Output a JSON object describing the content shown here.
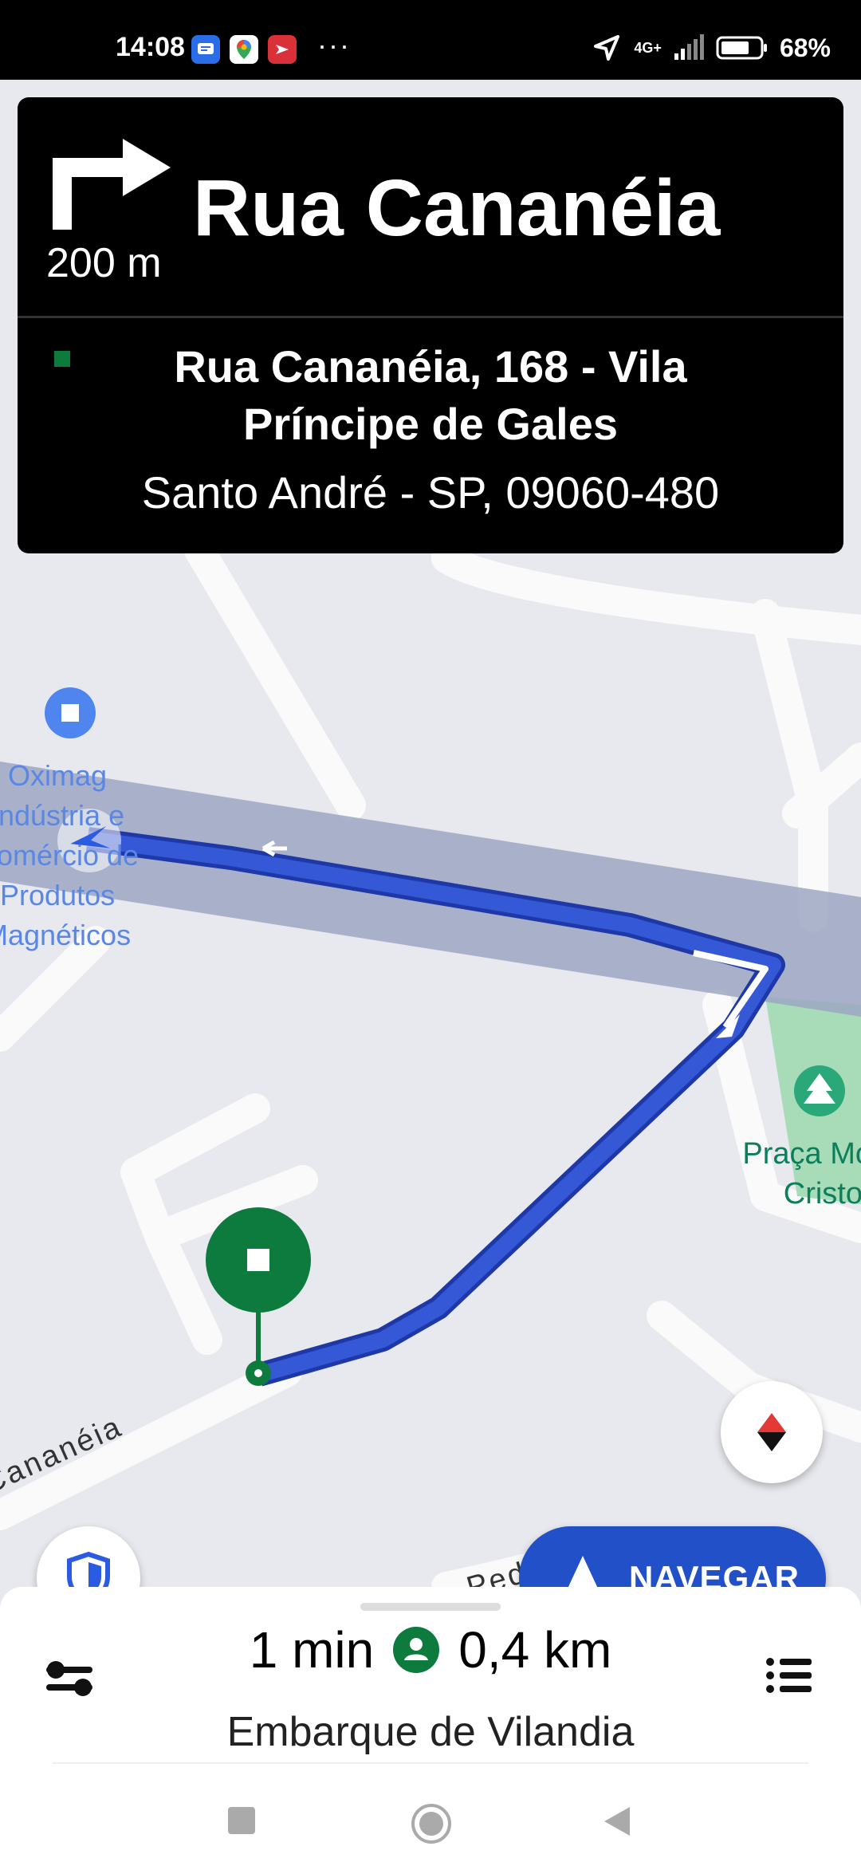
{
  "status_bar": {
    "time": "14:08",
    "app_icons": [
      "messages-icon",
      "maps-icon",
      "app-icon"
    ],
    "more": "···",
    "network": "4G+",
    "battery": "68%"
  },
  "navigation_card": {
    "turn_icon": "turn-right-arrow-icon",
    "distance": "200 m",
    "street": "Rua Cananéia",
    "destination_line1": "Rua Cananéia, 168 - Vila",
    "destination_line2": "Príncipe de Gales",
    "destination_line3": "Santo André - SP, 09060-480"
  },
  "map": {
    "poi_label_lines": [
      "Oximag",
      "Indústria e",
      "Comércio de",
      "Produtos",
      "Magnéticos"
    ],
    "park_label_lines": [
      "Praça Mo",
      "Cristo"
    ],
    "street_label_bottom": "Cananéia",
    "street_label_bottom_right": "Pedrad"
  },
  "buttons": {
    "navigate": "NAVEGAR"
  },
  "bottom_sheet": {
    "duration": "1 min",
    "distance": "0,4 km",
    "destination": "Embarque de Vilandia"
  },
  "colors": {
    "route_blue": "#2d4fc9",
    "pin_green": "#0d7a3e",
    "nav_button": "#2150c8"
  }
}
